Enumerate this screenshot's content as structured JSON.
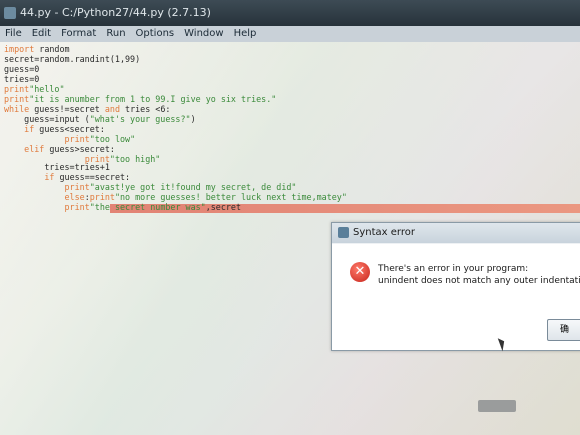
{
  "window": {
    "title": "44.py - C:/Python27/44.py (2.7.13)"
  },
  "menu": {
    "items": [
      "File",
      "Edit",
      "Format",
      "Run",
      "Options",
      "Window",
      "Help"
    ]
  },
  "code": {
    "lines": [
      "import random",
      "secret=random.randint(1,99)",
      "guess=0",
      "tries=0",
      "print\"hello\"",
      "print\"it is anumber from 1 to 99.I give yo six tries.\"",
      "while guess!=secret and tries <6:",
      "    guess=input (\"what's your guess?\")",
      "    if guess<secret:",
      "            print\"too low\"",
      "    elif guess>secret:",
      "                print\"too high\"",
      "",
      "        tries=tries+1",
      "        if guess==secret:",
      "            print\"avast!ye got it!found my secret, de did\"",
      "            else:print\"no more guesses! better luck next time,matey\"",
      "            print\"the secret number was\",secret"
    ]
  },
  "dialog": {
    "title": "Syntax error",
    "message_line1": "There's an error in your program:",
    "message_line2": "unindent does not match any outer indentation le",
    "ok_label": "确"
  },
  "icons": {
    "error": "error-icon",
    "app": "python-idle-icon"
  }
}
